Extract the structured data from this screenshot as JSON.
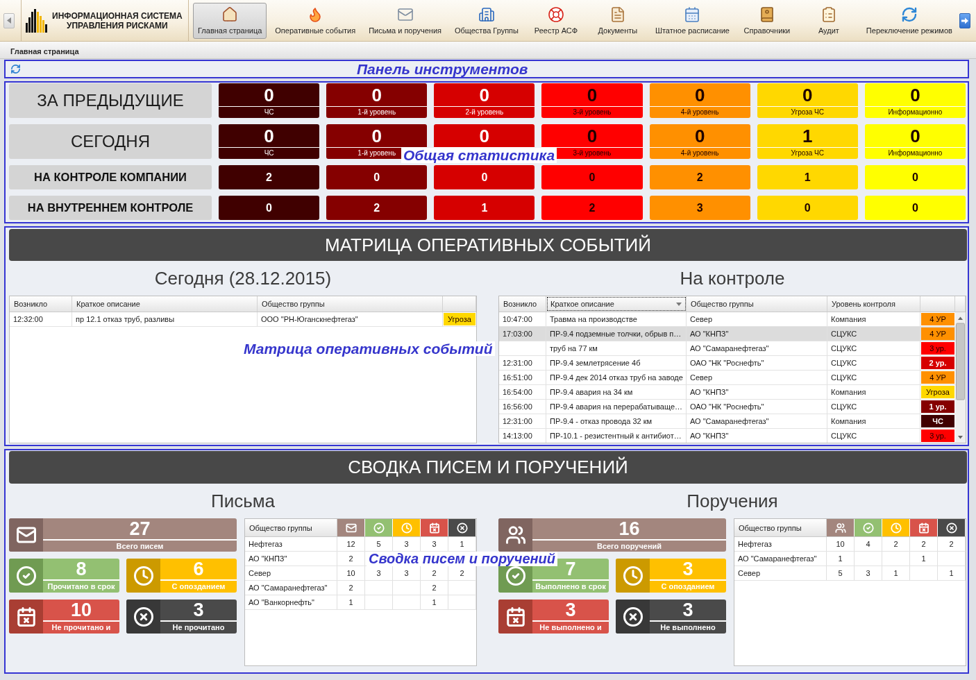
{
  "header": {
    "app_title": [
      "ИНФОРМАЦИОННАЯ СИСТЕМА",
      "УПРАВЛЕНИЯ РИСКАМИ"
    ],
    "nav": [
      {
        "kind": "home",
        "label": "Главная страница",
        "selected": true
      },
      {
        "kind": "events",
        "label": "Оперативные события",
        "selected": false
      },
      {
        "kind": "mail",
        "label": "Письма и поручения",
        "selected": false
      },
      {
        "kind": "companies",
        "label": "Общества Группы",
        "selected": false
      },
      {
        "kind": "rescue",
        "label": "Реестр АСФ",
        "selected": false
      },
      {
        "kind": "documents",
        "label": "Документы",
        "selected": false
      },
      {
        "kind": "staff",
        "label": "Штатное расписание",
        "selected": false
      },
      {
        "kind": "directory",
        "label": "Справочники",
        "selected": false
      },
      {
        "kind": "audit",
        "label": "Аудит",
        "selected": false
      },
      {
        "kind": "modes",
        "label": "Переключение режимов",
        "selected": false
      }
    ]
  },
  "breadcrumb": "Главная страница",
  "toolbar": {
    "annotation": "Панель инструментов"
  },
  "stats": {
    "annotation": "Общая статистика",
    "rows": [
      {
        "title": "ЗА ПРЕДЫДУЩИЕ",
        "kind": "detailed",
        "cells": [
          {
            "value": "0",
            "caption": "ЧС",
            "color": "#400000"
          },
          {
            "value": "0",
            "caption": "1-й уровень",
            "color": "#850000"
          },
          {
            "value": "0",
            "caption": "2-й уровень",
            "color": "#d60000"
          },
          {
            "value": "0",
            "caption": "3-й уровень",
            "color": "#ff0000"
          },
          {
            "value": "0",
            "caption": "4-й уровень",
            "color": "#ff9000"
          },
          {
            "value": "0",
            "caption": "Угроза ЧС",
            "color": "#ffd800"
          },
          {
            "value": "0",
            "caption": "Информационно",
            "color": "#ffff00"
          }
        ]
      },
      {
        "title": "СЕГОДНЯ",
        "kind": "detailed",
        "cells": [
          {
            "value": "0",
            "caption": "ЧС",
            "color": "#400000"
          },
          {
            "value": "0",
            "caption": "1-й уровень",
            "color": "#850000"
          },
          {
            "value": "0",
            "color": "#d60000"
          },
          {
            "value": "0",
            "caption": "3-й уровень",
            "color": "#ff0000"
          },
          {
            "value": "0",
            "caption": "4-й уровень",
            "color": "#ff9000"
          },
          {
            "value": "1",
            "caption": "Угроза ЧС",
            "color": "#ffd800"
          },
          {
            "value": "0",
            "caption": "Информационно",
            "color": "#ffff00"
          }
        ]
      },
      {
        "title": "НА КОНТРОЛЕ КОМПАНИИ",
        "kind": "compact",
        "cells": [
          {
            "value": "2",
            "color": "#400000"
          },
          {
            "value": "0",
            "color": "#850000"
          },
          {
            "value": "0",
            "color": "#d60000"
          },
          {
            "value": "0",
            "color": "#ff0000"
          },
          {
            "value": "2",
            "color": "#ff9000"
          },
          {
            "value": "1",
            "color": "#ffd800"
          },
          {
            "value": "0",
            "color": "#ffff00"
          }
        ]
      },
      {
        "title": "НА ВНУТРЕННЕМ КОНТРОЛЕ",
        "kind": "compact",
        "cells": [
          {
            "value": "0",
            "color": "#400000"
          },
          {
            "value": "2",
            "color": "#850000"
          },
          {
            "value": "1",
            "color": "#d60000"
          },
          {
            "value": "2",
            "color": "#ff0000"
          },
          {
            "value": "3",
            "color": "#ff9000"
          },
          {
            "value": "0",
            "color": "#ffd800"
          },
          {
            "value": "0",
            "color": "#ffff00"
          }
        ]
      }
    ]
  },
  "matrix": {
    "title": "МАТРИЦА ОПЕРАТИВНЫХ СОБЫТИЙ",
    "annotation": "Матрица оперативных событий",
    "today": {
      "title": "Сегодня (28.12.2015)",
      "columns": [
        {
          "label": "Возникло",
          "focused": false
        },
        {
          "label": "Краткое описание",
          "focused": false
        },
        {
          "label": "Общество группы",
          "focused": false
        }
      ],
      "rows": [
        {
          "time": "12:32:00",
          "description": "пр 12.1 отказ труб, разливы",
          "company": "ООО \"РН-Юганскнефтегаз\"",
          "level": "Угроза",
          "color": "#ffd800",
          "selected": false
        }
      ]
    },
    "control": {
      "title": "На контроле",
      "columns": [
        {
          "label": "Возникло",
          "focused": false
        },
        {
          "label": "Краткое описание",
          "focused": true
        },
        {
          "label": "Общество группы",
          "focused": false
        },
        {
          "label": "Уровень контроля",
          "focused": false
        }
      ],
      "rows": [
        {
          "time": "10:47:00",
          "description": "Травма на производстве",
          "company": "Север",
          "control": "Компания",
          "level": "4 УР",
          "color": "#ff9000",
          "selected": false
        },
        {
          "time": "17:03:00",
          "description": "ПР-9.4 подземные толчки, обрыв п…",
          "company": "АО \"КНПЗ\"",
          "control": "СЦУКС",
          "level": "4 УР",
          "color": "#ff9000",
          "selected": true
        },
        {
          "description": "труб на 77 км",
          "company": "АО \"Самаранефтегаз\"",
          "control": "СЦУКС",
          "level": "3 ур.",
          "color": "#ff0000",
          "selected": false
        },
        {
          "time": "12:31:00",
          "description": "ПР-9.4 землетрясение 4б",
          "company": "ОАО \"НК \"Роснефть\"",
          "control": "СЦУКС",
          "level": "2 ур.",
          "color": "#d60000",
          "selected": false
        },
        {
          "time": "16:51:00",
          "description": "ПР-9.4 дек 2014 отказ труб на заводе",
          "company": "Север",
          "control": "СЦУКС",
          "level": "4 УР",
          "color": "#ff9000",
          "selected": false
        },
        {
          "time": "16:54:00",
          "description": "ПР-9.4 авария на 34 км",
          "company": "АО \"КНПЗ\"",
          "control": "Компания",
          "level": "Угроза",
          "color": "#ffd800",
          "selected": false
        },
        {
          "time": "16:56:00",
          "description": "ПР-9.4 авария на перерабатываще…",
          "company": "ОАО \"НК \"Роснефть\"",
          "control": "СЦУКС",
          "level": "1 ур.",
          "color": "#850000",
          "selected": false
        },
        {
          "time": "12:31:00",
          "description": "ПР-9.4 - отказ провода 32 км",
          "company": "АО \"Самаранефтегаз\"",
          "control": "Компания",
          "level": "ЧС",
          "color": "#400000",
          "selected": false
        },
        {
          "time": "14:13:00",
          "description": "ПР-10.1 - резистентный к антибиот…",
          "company": "АО \"КНПЗ\"",
          "control": "СЦУКС",
          "level": "3 ур.",
          "color": "#ff0000",
          "selected": false
        }
      ]
    }
  },
  "summary": {
    "title": "СВОДКА ПИСЕМ И ПОРУЧЕНИЙ",
    "annotation": "Сводка писем и поручений",
    "panels": [
      {
        "kind": "letters",
        "title": "Письма",
        "cards": [
          {
            "kind": "total",
            "value": "27",
            "caption": "Всего писем"
          },
          {
            "kind": "ontime",
            "value": "8",
            "caption": "Прочитано в срок"
          },
          {
            "kind": "late",
            "value": "6",
            "caption": "С опозданием"
          },
          {
            "kind": "overdue",
            "value": "10",
            "caption": "Не прочитано и"
          },
          {
            "kind": "failed",
            "value": "3",
            "caption": "Не прочитано"
          }
        ],
        "table": {
          "name_column": "Общество группы",
          "rows": [
            {
              "name": "Нефтегаз",
              "total": "12",
              "ontime": "5",
              "late": "3",
              "overdue": "3",
              "failed": "1"
            },
            {
              "name": "АО \"КНПЗ\"",
              "total": "2"
            },
            {
              "name": "Север",
              "total": "10",
              "ontime": "3",
              "late": "3",
              "overdue": "2",
              "failed": "2"
            },
            {
              "name": "АО \"Самаранефтегаз\"",
              "total": "2",
              "overdue": "2"
            },
            {
              "name": "АО \"Ванкорнефть\"",
              "total": "1",
              "overdue": "1"
            }
          ]
        }
      },
      {
        "kind": "orders",
        "title": "Поручения",
        "cards": [
          {
            "kind": "total",
            "value": "16",
            "caption": "Всего поручений"
          },
          {
            "kind": "ontime",
            "value": "7",
            "caption": "Выполнено в срок"
          },
          {
            "kind": "late",
            "value": "3",
            "caption": "С опозданием"
          },
          {
            "kind": "overdue",
            "value": "3",
            "caption": "Не выполнено и"
          },
          {
            "kind": "failed",
            "value": "3",
            "caption": "Не выполнено"
          }
        ],
        "table": {
          "name_column": "Общество группы",
          "rows": [
            {
              "name": "Нефтегаз",
              "total": "10",
              "ontime": "4",
              "late": "2",
              "overdue": "2",
              "failed": "2"
            },
            {
              "name": "АО \"Самаранефтегаз\"",
              "total": "1",
              "overdue": "1"
            },
            {
              "name": "Север",
              "total": "5",
              "ontime": "3",
              "late": "1",
              "failed": "1"
            }
          ]
        }
      }
    ]
  }
}
